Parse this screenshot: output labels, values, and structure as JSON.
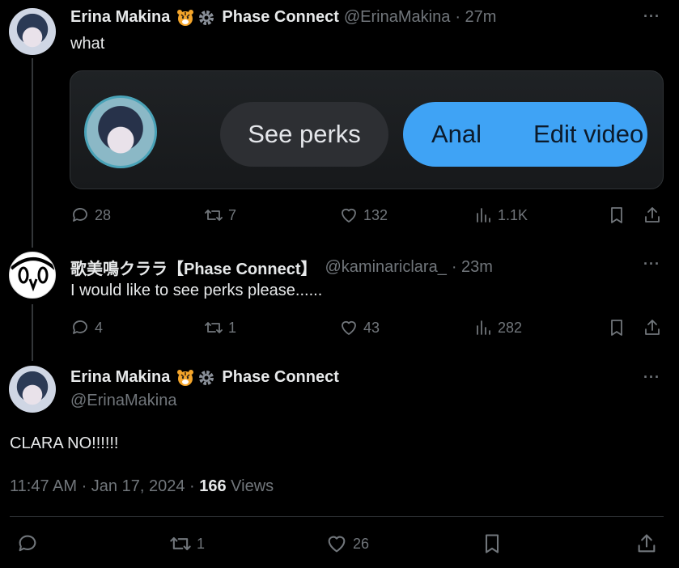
{
  "tweet1": {
    "name": "Erina Makina",
    "affiliation": "Phase Connect",
    "handle": "@ErinaMakina",
    "time": "· 27m",
    "text": "what",
    "media": {
      "button_perks": "See perks",
      "button_anal": "Anal",
      "button_edit": "Edit video"
    },
    "stats": {
      "replies": "28",
      "reposts": "7",
      "likes": "132",
      "views": "1.1K"
    }
  },
  "tweet2": {
    "name": "歌美鳴クララ【Phase Connect】",
    "handle": "@kaminariclara_",
    "time": "· 23m",
    "text": "I would like to see perks please......",
    "stats": {
      "replies": "4",
      "reposts": "1",
      "likes": "43",
      "views": "282"
    }
  },
  "main": {
    "name": "Erina Makina",
    "affiliation": "Phase Connect",
    "handle": "@ErinaMakina",
    "text": "CLARA NO!!!!!!",
    "timestamp": "11:47 AM · Jan 17, 2024 · ",
    "views_count": "166",
    "views_label": " Views",
    "stats": {
      "reposts": "1",
      "likes": "26"
    }
  },
  "icons": {
    "tiger": "tiger-emoji",
    "gear": "gear-emoji",
    "more": "more-icon",
    "reply": "reply-icon",
    "repost": "repost-icon",
    "like": "like-icon",
    "views": "views-icon",
    "bookmark": "bookmark-icon",
    "share": "share-icon"
  },
  "colors": {
    "accent": "#3fa3f5",
    "muted": "#71767b",
    "text": "#e7e9ea"
  }
}
